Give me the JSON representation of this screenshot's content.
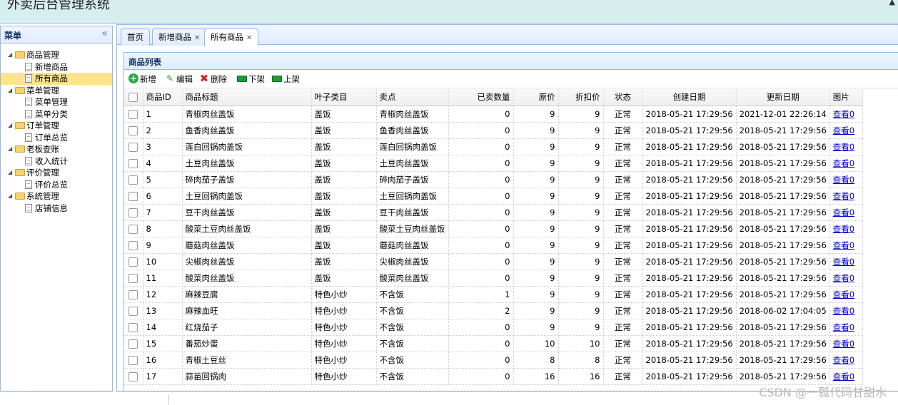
{
  "app": {
    "title": "外卖后台管理系统"
  },
  "menu": {
    "title": "菜单",
    "groups": [
      {
        "label": "商品管理",
        "items": [
          {
            "label": "新增商品"
          },
          {
            "label": "所有商品"
          }
        ]
      },
      {
        "label": "菜单管理",
        "items": [
          {
            "label": "菜单管理"
          },
          {
            "label": "菜单分类"
          }
        ]
      },
      {
        "label": "订单管理",
        "items": [
          {
            "label": "订单总览"
          }
        ]
      },
      {
        "label": "老板查账",
        "items": [
          {
            "label": "收入统计"
          }
        ]
      },
      {
        "label": "评价管理",
        "items": [
          {
            "label": "评价总览"
          }
        ]
      },
      {
        "label": "系统管理",
        "items": [
          {
            "label": "店铺信息"
          }
        ]
      }
    ],
    "selected": "所有商品"
  },
  "tabs": [
    {
      "label": "首页",
      "closable": false
    },
    {
      "label": "新增商品",
      "closable": true
    },
    {
      "label": "所有商品",
      "closable": true,
      "active": true
    }
  ],
  "grid": {
    "title": "商品列表",
    "toolbar": {
      "add": "新增",
      "edit": "编辑",
      "delete": "删除",
      "off_shelf": "下架",
      "on_shelf": "上架"
    },
    "columns": [
      "商品ID",
      "商品标题",
      "叶子类目",
      "卖点",
      "已卖数量",
      "原价",
      "折扣价",
      "状态",
      "创建日期",
      "更新日期",
      "图片"
    ],
    "rows": [
      [
        "1",
        "青椒肉丝盖饭",
        "盖饭",
        "青椒肉丝盖饭",
        "0",
        "9",
        "9",
        "正常",
        "2018-05-21 17:29:56",
        "2021-12-01 22:26:14",
        "查看0"
      ],
      [
        "2",
        "鱼香肉丝盖饭",
        "盖饭",
        "鱼香肉丝盖饭",
        "0",
        "9",
        "9",
        "正常",
        "2018-05-21 17:29:56",
        "2018-05-21 17:29:56",
        "查看0"
      ],
      [
        "3",
        "莲白回锅肉盖饭",
        "盖饭",
        "莲白回锅肉盖饭",
        "0",
        "9",
        "9",
        "正常",
        "2018-05-21 17:29:56",
        "2018-05-21 17:29:56",
        "查看0"
      ],
      [
        "4",
        "土豆肉丝盖饭",
        "盖饭",
        "土豆肉丝盖饭",
        "0",
        "9",
        "9",
        "正常",
        "2018-05-21 17:29:56",
        "2018-05-21 17:29:56",
        "查看0"
      ],
      [
        "5",
        "碎肉茄子盖饭",
        "盖饭",
        "碎肉茄子盖饭",
        "0",
        "9",
        "9",
        "正常",
        "2018-05-21 17:29:56",
        "2018-05-21 17:29:56",
        "查看0"
      ],
      [
        "6",
        "土豆回锅肉盖饭",
        "盖饭",
        "土豆回锅肉盖饭",
        "0",
        "9",
        "9",
        "正常",
        "2018-05-21 17:29:56",
        "2018-05-21 17:29:56",
        "查看0"
      ],
      [
        "7",
        "豆干肉丝盖饭",
        "盖饭",
        "豆干肉丝盖饭",
        "0",
        "9",
        "9",
        "正常",
        "2018-05-21 17:29:56",
        "2018-05-21 17:29:56",
        "查看0"
      ],
      [
        "8",
        "酸菜土豆肉丝盖饭",
        "盖饭",
        "酸菜土豆肉丝盖饭",
        "0",
        "9",
        "9",
        "正常",
        "2018-05-21 17:29:56",
        "2018-05-21 17:29:56",
        "查看0"
      ],
      [
        "9",
        "蘑菇肉丝盖饭",
        "盖饭",
        "蘑菇肉丝盖饭",
        "0",
        "9",
        "9",
        "正常",
        "2018-05-21 17:29:56",
        "2018-05-21 17:29:56",
        "查看0"
      ],
      [
        "10",
        "尖椒肉丝盖饭",
        "盖饭",
        "尖椒肉丝盖饭",
        "0",
        "9",
        "9",
        "正常",
        "2018-05-21 17:29:56",
        "2018-05-21 17:29:56",
        "查看0"
      ],
      [
        "11",
        "酸菜肉丝盖饭",
        "盖饭",
        "酸菜肉丝盖饭",
        "0",
        "9",
        "9",
        "正常",
        "2018-05-21 17:29:56",
        "2018-05-21 17:29:56",
        "查看0"
      ],
      [
        "12",
        "麻辣豆腐",
        "特色小炒",
        "不含饭",
        "1",
        "9",
        "9",
        "正常",
        "2018-05-21 17:29:56",
        "2018-05-21 17:29:56",
        "查看0"
      ],
      [
        "13",
        "麻辣血旺",
        "特色小炒",
        "不含饭",
        "2",
        "9",
        "9",
        "正常",
        "2018-05-21 17:29:56",
        "2018-06-02 17:04:05",
        "查看0"
      ],
      [
        "14",
        "红烧茄子",
        "特色小炒",
        "不含饭",
        "0",
        "9",
        "9",
        "正常",
        "2018-05-21 17:29:56",
        "2018-05-21 17:29:56",
        "查看0"
      ],
      [
        "15",
        "番茄炒蛋",
        "特色小炒",
        "不含饭",
        "0",
        "10",
        "10",
        "正常",
        "2018-05-21 17:29:56",
        "2018-05-21 17:29:56",
        "查看0"
      ],
      [
        "16",
        "青椒土豆丝",
        "特色小炒",
        "不含饭",
        "0",
        "8",
        "8",
        "正常",
        "2018-05-21 17:29:56",
        "2018-05-21 17:29:56",
        "查看0"
      ],
      [
        "17",
        "蒜苗回锅肉",
        "特色小炒",
        "不含饭",
        "0",
        "16",
        "16",
        "正常",
        "2018-05-21 17:29:56",
        "2018-05-21 17:29:56",
        "查看0"
      ]
    ]
  },
  "watermark": "CSDN @一瓢代码甘甜水"
}
